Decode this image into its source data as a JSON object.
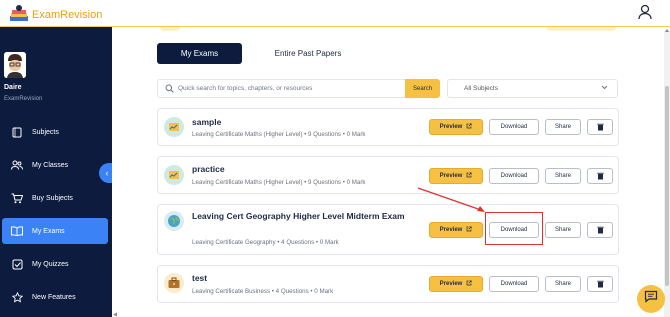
{
  "brand": {
    "prefix": "Exam",
    "suffix": "Revision"
  },
  "user": {
    "name": "Daire",
    "org": "ExamRevision"
  },
  "sidebar": {
    "items": [
      {
        "label": "Subjects",
        "icon": "book-icon"
      },
      {
        "label": "My Classes",
        "icon": "users-icon"
      },
      {
        "label": "Buy Subjects",
        "icon": "cart-icon"
      },
      {
        "label": "My Exams",
        "icon": "open-book-icon",
        "active": true
      },
      {
        "label": "My Quizzes",
        "icon": "check-square-icon"
      },
      {
        "label": "New Features",
        "icon": "star-icon"
      }
    ]
  },
  "tabs": {
    "active": "My Exams",
    "other": "Entire Past Papers"
  },
  "search": {
    "placeholder": "Quick search for topics, chapters, or resources",
    "button": "Search"
  },
  "filter": {
    "selected": "All Subjects"
  },
  "actions": {
    "preview": "Preview",
    "download": "Download",
    "share": "Share"
  },
  "exams": [
    {
      "title": "sample",
      "meta": "Leaving Certificate Maths (Higher Level) • 9 Questions • 0 Mark",
      "thumb": "chart-thumb"
    },
    {
      "title": "practice",
      "meta": "Leaving Certificate Maths (Higher Level) • 9 Questions • 0 Mark",
      "thumb": "chart-thumb"
    },
    {
      "title": "Leaving Cert Geography Higher Level Midterm Exam",
      "meta": "Leaving Certificate Geography • 4 Questions • 0 Mark",
      "thumb": "globe-thumb"
    },
    {
      "title": "test",
      "meta": "Leaving Certificate Business • 4 Questions • 0 Mark",
      "thumb": "briefcase-thumb"
    }
  ],
  "colors": {
    "navy": "#0d1b3e",
    "accent": "#f6c042",
    "active": "#3b82f6",
    "highlight": "#d33"
  }
}
